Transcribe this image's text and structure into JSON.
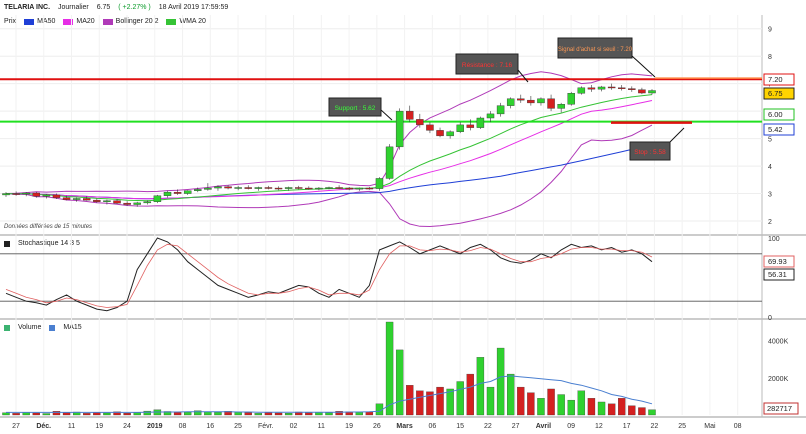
{
  "header": {
    "name": "TELARIA INC.",
    "period": "Journalier",
    "price": "6.75",
    "change": "( +2.27% )",
    "datetime": "18 Avril 2019 17:59:59"
  },
  "legend": {
    "items": [
      {
        "label": "Prix",
        "color": ""
      },
      {
        "label": "MA50",
        "color": "#1f3fd6"
      },
      {
        "label": "MA20",
        "color": "#e62ee6"
      },
      {
        "label": "Bollinger 20 2",
        "color": "#b03ab8"
      },
      {
        "label": "WMA 20",
        "color": "#35c335"
      }
    ]
  },
  "delay_note": "Données différées de 15 minutes",
  "stoch_legend": "Stochastique 14 3 5",
  "volume_legend": {
    "volume": "Volume",
    "ma": "MA15"
  },
  "annotations": {
    "support": "Support : 5.62",
    "resistance": "Résistance : 7.16",
    "signal": "Signal d'achat si seuil : 7.20",
    "stop": "Stop : 5.58"
  },
  "price_tags": {
    "t720": "7.20",
    "t675": "6.75",
    "t600": "6.00",
    "t542": "5.42"
  },
  "stoch_tags": {
    "k": "69.93",
    "d": "56.31"
  },
  "volume_tags": {
    "v": "282717"
  },
  "colors": {
    "up": "#2fd12f",
    "down": "#d42020",
    "resistance": "#e01010",
    "support": "#20e020",
    "stop": "#e01010",
    "signal": "#ff8844",
    "ma50": "#1f3fd6",
    "ma20": "#e62ee6",
    "boll": "#b03ab8",
    "wma": "#35c335",
    "vol_ma": "#4a7fd0"
  },
  "chart_data": [
    {
      "type": "candlestick",
      "title": "TELARIA INC. Journalier",
      "y_ticks": [
        "2",
        "3",
        "4",
        "5",
        "6",
        "7",
        "8",
        "9"
      ],
      "ylim": [
        1.6,
        9.5
      ],
      "x_ticks": [
        "27",
        "Déc.",
        "11",
        "19",
        "24",
        "2019",
        "08",
        "16",
        "25",
        "Févr.",
        "02",
        "11",
        "19",
        "26",
        "Mars",
        "06",
        "15",
        "22",
        "27",
        "Avril",
        "09",
        "12",
        "17",
        "22",
        "25",
        "Mai",
        "08"
      ],
      "candles": [
        [
          2.95,
          3.05,
          2.88,
          3.0
        ],
        [
          3.0,
          3.08,
          2.92,
          2.98
        ],
        [
          2.98,
          3.05,
          2.9,
          3.02
        ],
        [
          3.02,
          3.06,
          2.85,
          2.9
        ],
        [
          2.9,
          2.98,
          2.82,
          2.95
        ],
        [
          2.95,
          3.0,
          2.8,
          2.85
        ],
        [
          2.85,
          2.92,
          2.75,
          2.78
        ],
        [
          2.78,
          2.85,
          2.7,
          2.82
        ],
        [
          2.82,
          2.9,
          2.74,
          2.76
        ],
        [
          2.76,
          2.82,
          2.66,
          2.7
        ],
        [
          2.7,
          2.78,
          2.6,
          2.74
        ],
        [
          2.74,
          2.8,
          2.62,
          2.65
        ],
        [
          2.65,
          2.72,
          2.55,
          2.6
        ],
        [
          2.6,
          2.7,
          2.52,
          2.66
        ],
        [
          2.66,
          2.75,
          2.6,
          2.7
        ],
        [
          2.7,
          2.95,
          2.65,
          2.92
        ],
        [
          2.92,
          3.1,
          2.85,
          3.05
        ],
        [
          3.05,
          3.15,
          2.95,
          3.0
        ],
        [
          3.0,
          3.12,
          2.95,
          3.1
        ],
        [
          3.1,
          3.22,
          3.05,
          3.15
        ],
        [
          3.15,
          3.38,
          3.1,
          3.2
        ],
        [
          3.2,
          3.3,
          3.1,
          3.25
        ],
        [
          3.25,
          3.3,
          3.15,
          3.2
        ],
        [
          3.2,
          3.28,
          3.12,
          3.22
        ],
        [
          3.22,
          3.3,
          3.15,
          3.18
        ],
        [
          3.18,
          3.25,
          3.1,
          3.22
        ],
        [
          3.22,
          3.28,
          3.15,
          3.2
        ],
        [
          3.2,
          3.26,
          3.12,
          3.18
        ],
        [
          3.18,
          3.25,
          3.1,
          3.22
        ],
        [
          3.22,
          3.28,
          3.15,
          3.2
        ],
        [
          3.2,
          3.26,
          3.14,
          3.18
        ],
        [
          3.18,
          3.24,
          3.12,
          3.2
        ],
        [
          3.2,
          3.25,
          3.15,
          3.22
        ],
        [
          3.22,
          3.3,
          3.16,
          3.2
        ],
        [
          3.2,
          3.24,
          3.12,
          3.16
        ],
        [
          3.16,
          3.22,
          3.1,
          3.2
        ],
        [
          3.2,
          3.24,
          3.14,
          3.18
        ],
        [
          3.18,
          3.6,
          3.1,
          3.55
        ],
        [
          3.55,
          4.8,
          3.5,
          4.7
        ],
        [
          4.7,
          6.1,
          4.6,
          6.0
        ],
        [
          6.0,
          6.2,
          5.6,
          5.7
        ],
        [
          5.7,
          5.9,
          5.4,
          5.5
        ],
        [
          5.5,
          5.6,
          5.2,
          5.3
        ],
        [
          5.3,
          5.4,
          5.05,
          5.1
        ],
        [
          5.1,
          5.3,
          5.0,
          5.25
        ],
        [
          5.25,
          5.6,
          5.2,
          5.5
        ],
        [
          5.5,
          5.7,
          5.3,
          5.4
        ],
        [
          5.4,
          5.8,
          5.35,
          5.75
        ],
        [
          5.75,
          6.0,
          5.6,
          5.9
        ],
        [
          5.9,
          6.3,
          5.8,
          6.2
        ],
        [
          6.2,
          6.5,
          6.1,
          6.45
        ],
        [
          6.45,
          6.6,
          6.3,
          6.4
        ],
        [
          6.4,
          6.55,
          6.2,
          6.3
        ],
        [
          6.3,
          6.5,
          6.2,
          6.45
        ],
        [
          6.45,
          6.6,
          6.0,
          6.1
        ],
        [
          6.1,
          6.3,
          5.95,
          6.25
        ],
        [
          6.25,
          6.7,
          6.2,
          6.65
        ],
        [
          6.65,
          6.9,
          6.6,
          6.85
        ],
        [
          6.85,
          6.95,
          6.7,
          6.8
        ],
        [
          6.8,
          6.92,
          6.72,
          6.88
        ],
        [
          6.88,
          7.0,
          6.78,
          6.85
        ],
        [
          6.85,
          6.95,
          6.75,
          6.82
        ],
        [
          6.82,
          6.9,
          6.7,
          6.78
        ],
        [
          6.78,
          6.85,
          6.62,
          6.66
        ],
        [
          6.66,
          6.8,
          6.6,
          6.75
        ]
      ]
    },
    {
      "type": "line",
      "title": "Stochastique 14 3 5",
      "y_ticks": [
        "0",
        "100"
      ],
      "ylim": [
        0,
        100
      ],
      "series": [
        {
          "name": "%K",
          "values": [
            30,
            25,
            20,
            18,
            15,
            22,
            28,
            20,
            15,
            10,
            8,
            12,
            20,
            60,
            80,
            100,
            95,
            85,
            70,
            60,
            50,
            40,
            35,
            30,
            25,
            28,
            32,
            30,
            35,
            40,
            38,
            30,
            25,
            35,
            30,
            25,
            40,
            85,
            90,
            95,
            88,
            80,
            85,
            90,
            85,
            80,
            88,
            92,
            85,
            75,
            70,
            68,
            72,
            80,
            75,
            85,
            92,
            88,
            90,
            85,
            88,
            82,
            85,
            80,
            70
          ]
        },
        {
          "name": "%D",
          "values": [
            35,
            30,
            25,
            22,
            18,
            20,
            24,
            22,
            18,
            14,
            12,
            13,
            16,
            40,
            65,
            85,
            92,
            90,
            80,
            70,
            60,
            50,
            42,
            36,
            30,
            28,
            30,
            30,
            32,
            36,
            38,
            34,
            28,
            30,
            30,
            28,
            34,
            60,
            80,
            90,
            90,
            85,
            84,
            86,
            85,
            82,
            84,
            88,
            86,
            80,
            74,
            70,
            70,
            74,
            76,
            80,
            86,
            88,
            88,
            86,
            86,
            84,
            84,
            82,
            76
          ]
        }
      ]
    },
    {
      "type": "bar",
      "title": "Volume",
      "y_ticks": [
        "2000K",
        "4000K"
      ],
      "ylim": [
        0,
        5000
      ],
      "series": [
        {
          "name": "Volume",
          "values": [
            120,
            90,
            150,
            110,
            80,
            200,
            130,
            160,
            90,
            140,
            110,
            170,
            100,
            130,
            210,
            280,
            190,
            140,
            160,
            230,
            180,
            150,
            200,
            170,
            130,
            90,
            140,
            110,
            100,
            160,
            120,
            150,
            130,
            200,
            170,
            150,
            180,
            600,
            5300,
            3500,
            1600,
            1300,
            1250,
            1500,
            1400,
            1800,
            2200,
            3100,
            1500,
            3600,
            2200,
            1500,
            1200,
            900,
            1400,
            1100,
            800,
            1300,
            900,
            700,
            600,
            900,
            500,
            400,
            283
          ]
        },
        {
          "name": "MA15",
          "values": [
            140,
            140,
            140,
            140,
            140,
            140,
            140,
            140,
            140,
            140,
            140,
            140,
            140,
            140,
            150,
            160,
            160,
            160,
            170,
            170,
            170,
            170,
            170,
            160,
            160,
            150,
            150,
            150,
            150,
            150,
            150,
            150,
            150,
            150,
            160,
            160,
            170,
            200,
            550,
            750,
            850,
            950,
            1050,
            1150,
            1250,
            1380,
            1500,
            1700,
            1800,
            2050,
            2100,
            2050,
            2000,
            1950,
            1900,
            1850,
            1700,
            1600,
            1450,
            1300,
            1100,
            1000,
            850,
            750,
            600
          ]
        }
      ]
    }
  ]
}
